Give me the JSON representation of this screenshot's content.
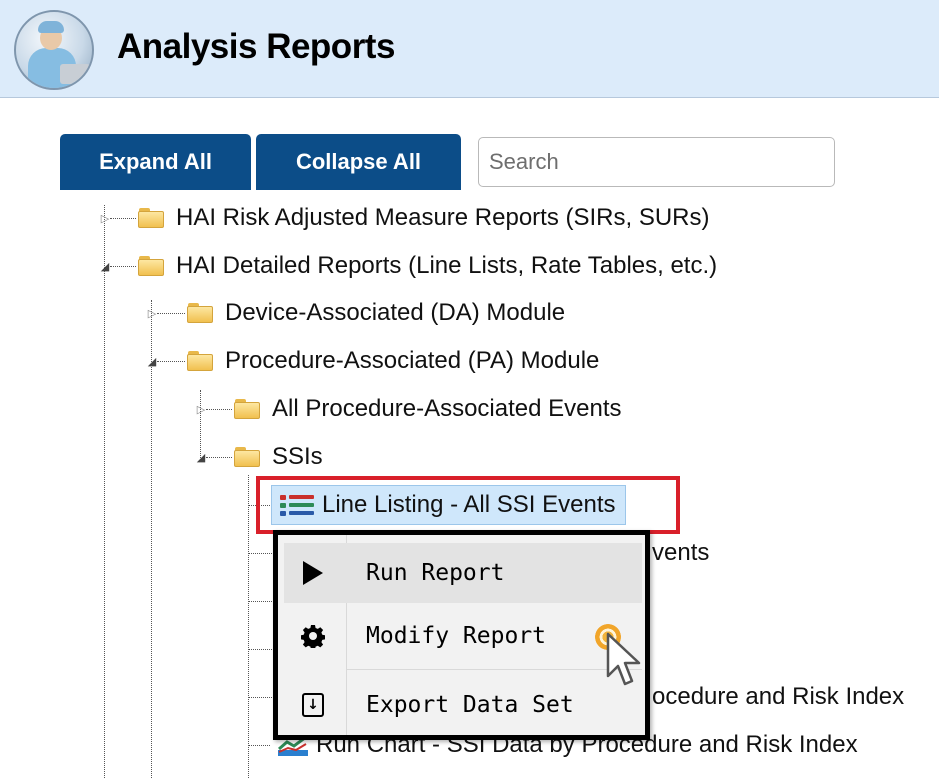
{
  "header": {
    "title": "Analysis Reports"
  },
  "toolbar": {
    "expand_label": "Expand All",
    "collapse_label": "Collapse All",
    "search_placeholder": "Search"
  },
  "tree": {
    "items": [
      {
        "label": "HAI Risk Adjusted Measure Reports (SIRs, SURs)",
        "state": "collapsed"
      },
      {
        "label": "HAI Detailed Reports (Line Lists, Rate Tables, etc.)",
        "state": "expanded"
      },
      {
        "label": "Device-Associated (DA) Module",
        "state": "collapsed"
      },
      {
        "label": "Procedure-Associated (PA) Module",
        "state": "expanded"
      },
      {
        "label": "All Procedure-Associated Events",
        "state": "collapsed"
      },
      {
        "label": "SSIs",
        "state": "expanded"
      }
    ],
    "selected_report": "Line Listing - All SSI Events",
    "partial_labels": {
      "row2": "vents",
      "row5": "ocedure and Risk Index",
      "row6": "Run Chart - SSI Data by Procedure and Risk Index"
    }
  },
  "context_menu": {
    "items": [
      {
        "label": "Run Report",
        "icon": "play-icon"
      },
      {
        "label": "Modify Report",
        "icon": "gear-icon"
      },
      {
        "label": "Export Data Set",
        "icon": "export-icon"
      }
    ]
  },
  "colors": {
    "header_bg": "#dcebfa",
    "button_bg": "#0c4d88",
    "highlight_border": "#d9202a",
    "selected_bg": "#cfe7fb"
  }
}
